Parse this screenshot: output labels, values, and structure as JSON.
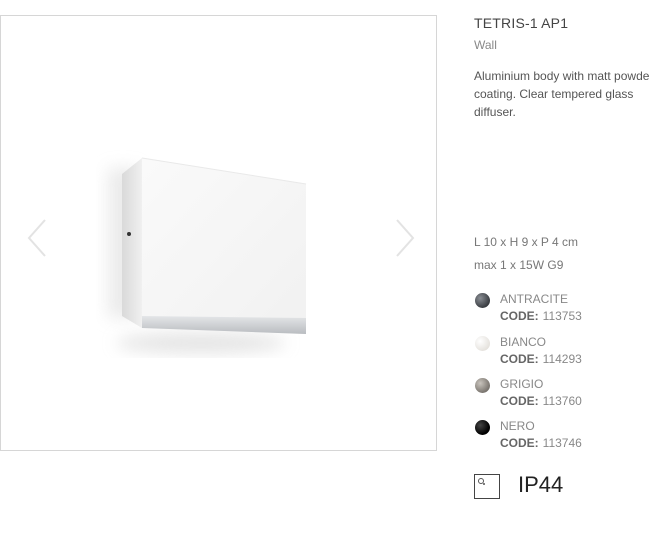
{
  "product": {
    "title": "TETRIS-1 AP1",
    "category": "Wall",
    "description_lines": [
      "Aluminium body with matt powde",
      "coating. Clear tempered glass",
      "diffuser."
    ],
    "dimensions": "L 10 x H 9 x P 4 cm",
    "power": "max 1 x 15W G9"
  },
  "colors": [
    {
      "name": "ANTRACITE",
      "code_label": "CODE:",
      "code": "113753",
      "hex": "#4a4d52"
    },
    {
      "name": "BIANCO",
      "code_label": "CODE:",
      "code": "114293",
      "hex": "#f1efec"
    },
    {
      "name": "GRIGIO",
      "code_label": "CODE:",
      "code": "113760",
      "hex": "#8a8580"
    },
    {
      "name": "NERO",
      "code_label": "CODE:",
      "code": "113746",
      "hex": "#0a0a0a"
    }
  ],
  "protection": {
    "rating": "IP44",
    "icon": "ip-rating-icon"
  },
  "gallery": {
    "prev_icon": "chevron-left-icon",
    "next_icon": "chevron-right-icon"
  }
}
